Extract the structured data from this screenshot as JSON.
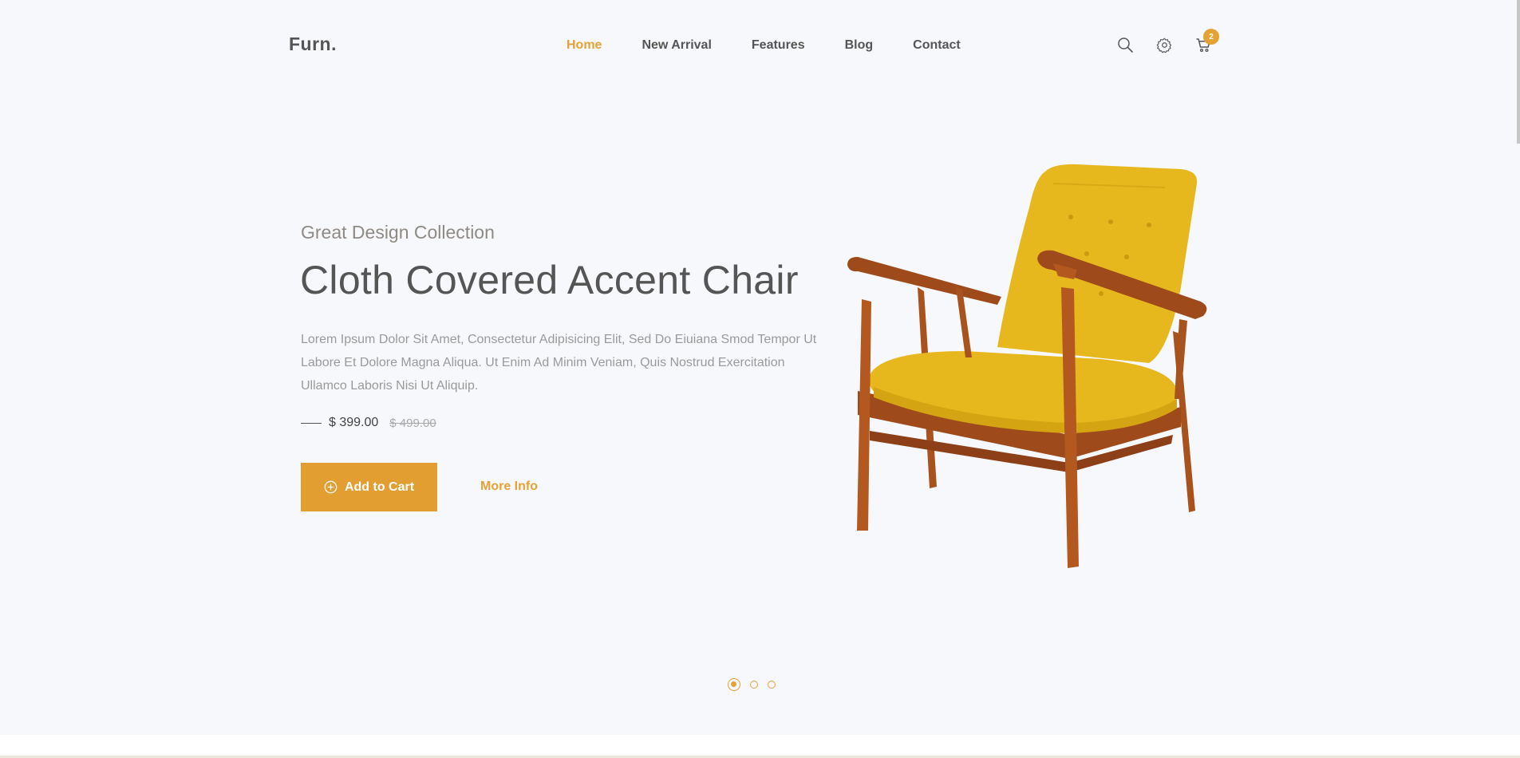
{
  "brand": {
    "logo": "Furn."
  },
  "nav": {
    "items": [
      {
        "label": "Home",
        "active": true
      },
      {
        "label": "New Arrival"
      },
      {
        "label": "Features"
      },
      {
        "label": "Blog"
      },
      {
        "label": "Contact"
      }
    ],
    "icons": [
      "search-icon",
      "gear-icon",
      "cart-icon"
    ],
    "cart_count": "2"
  },
  "hero": {
    "subtitle": "Great Design Collection",
    "title": "Cloth Covered Accent Chair",
    "description": "Lorem Ipsum Dolor Sit Amet, Consectetur Adipisicing Elit, Sed Do Eiuiana Smod Tempor Ut Labore Et Dolore Magna Aliqua. Ut Enim Ad Minim Veniam, Quis Nostrud Exercitation Ullamco Laboris Nisi Ut Aliquip.",
    "price": "$ 399.00",
    "old_price": "$ 499.00",
    "add_to_cart": "Add to Cart",
    "more_info": "More Info"
  },
  "slider": {
    "dots": 3,
    "active_index": 0
  },
  "colors": {
    "accent": "#e5a235",
    "text": "#555555",
    "background": "#f7f8fb",
    "chair_fabric": "#e7b81e",
    "chair_wood": "#a8521e"
  }
}
